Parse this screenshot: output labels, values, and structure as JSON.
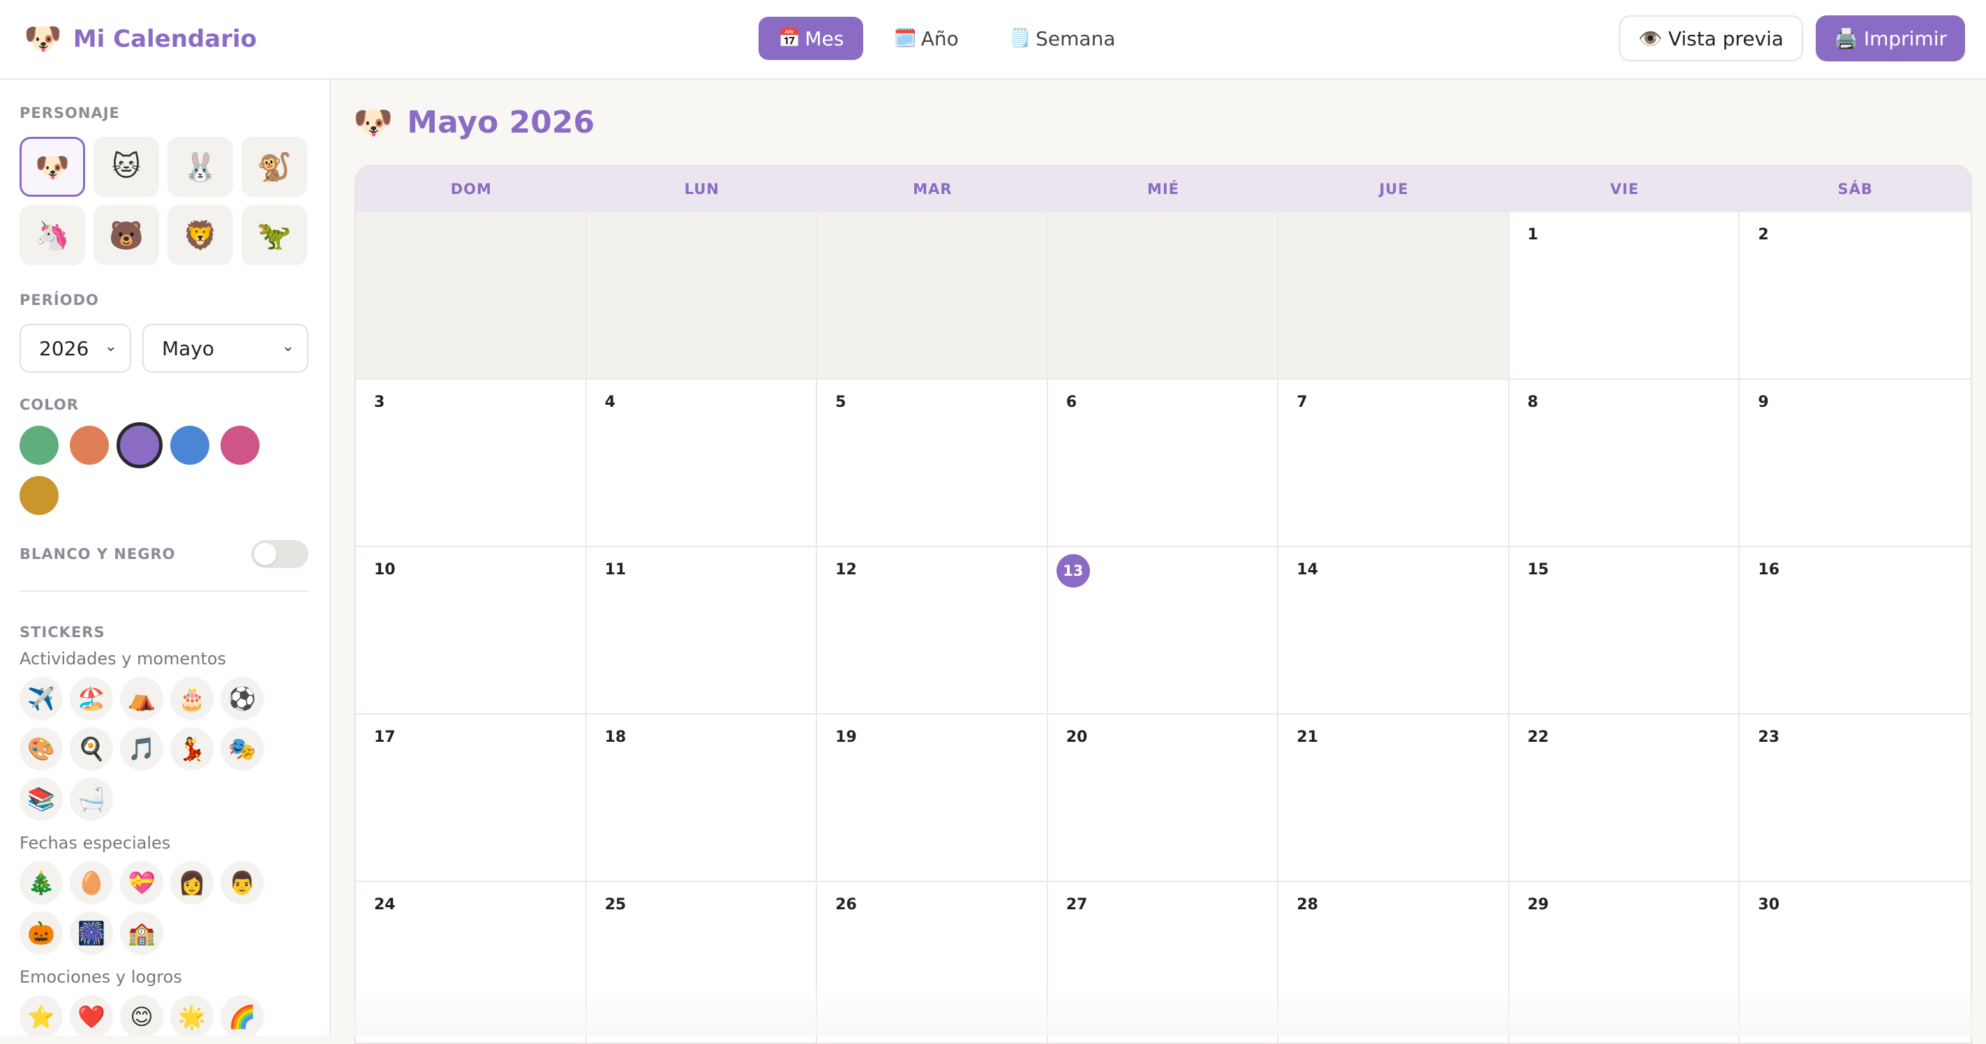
{
  "header": {
    "brand_emoji": "🐶",
    "brand_title": "Mi Calendario",
    "tabs": [
      {
        "icon": "📅",
        "label": "Mes",
        "active": true
      },
      {
        "icon": "🗓️",
        "label": "Año",
        "active": false
      },
      {
        "icon": "🗒️",
        "label": "Semana",
        "active": false
      }
    ],
    "preview_icon": "👁️",
    "preview_label": "Vista previa",
    "print_icon": "🖨️",
    "print_label": "Imprimir"
  },
  "sidebar": {
    "character_title": "PERSONAJE",
    "characters": [
      "🐶",
      "🐱",
      "🐰",
      "🐒",
      "🦄",
      "🐻",
      "🦁",
      "🦖"
    ],
    "selected_character": 0,
    "period_title": "PERÍODO",
    "year_value": "2026",
    "month_value": "Mayo",
    "color_title": "COLOR",
    "colors": [
      "#5fae7b",
      "#e07f55",
      "#8a6cc4",
      "#4a86d4",
      "#cf5586",
      "#c9962e"
    ],
    "selected_color": 2,
    "bw_title": "BLANCO Y NEGRO",
    "bw_enabled": false,
    "stickers_title": "STICKERS",
    "sticker_groups": [
      {
        "title": "Actividades y momentos",
        "items": [
          "✈️",
          "🏖️",
          "⛺",
          "🎂",
          "⚽",
          "🎨",
          "🍳",
          "🎵",
          "💃",
          "🎭",
          "📚",
          "🛁"
        ]
      },
      {
        "title": "Fechas especiales",
        "items": [
          "🎄",
          "🥚",
          "💝",
          "👩",
          "👨",
          "🎃",
          "🎆",
          "🏫"
        ]
      },
      {
        "title": "Emociones y logros",
        "items": [
          "⭐",
          "❤️",
          "😊",
          "🌟",
          "🌈"
        ]
      }
    ]
  },
  "main": {
    "emoji": "🐶",
    "title": "Mayo 2026",
    "weekdays": [
      "DOM",
      "LUN",
      "MAR",
      "MIÉ",
      "JUE",
      "VIE",
      "SÁB"
    ],
    "days": [
      "",
      "",
      "",
      "",
      "",
      "1",
      "2",
      "3",
      "4",
      "5",
      "6",
      "7",
      "8",
      "9",
      "10",
      "11",
      "12",
      "13",
      "14",
      "15",
      "16",
      "17",
      "18",
      "19",
      "20",
      "21",
      "22",
      "23",
      "24",
      "25",
      "26",
      "27",
      "28",
      "29",
      "30"
    ],
    "today": "13"
  }
}
